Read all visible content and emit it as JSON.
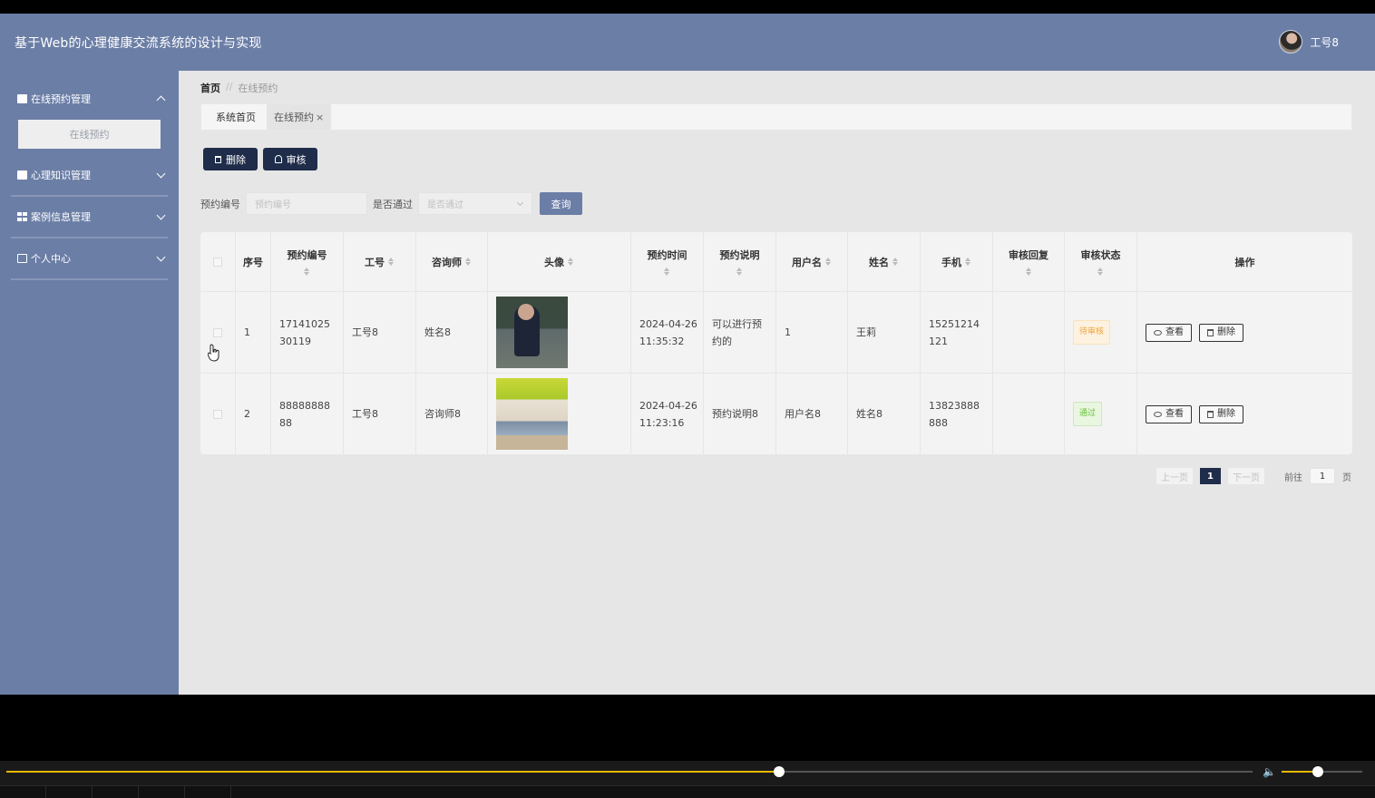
{
  "header": {
    "title": "基于Web的心理健康交流系统的设计与实现",
    "user_name": "工号8"
  },
  "sidebar": {
    "items": [
      {
        "label": "在线预约管理",
        "icon": "briefcase-icon",
        "expanded": true,
        "children": [
          {
            "label": "在线预约"
          }
        ]
      },
      {
        "label": "心理知识管理",
        "icon": "clipboard-icon",
        "expanded": false
      },
      {
        "label": "案例信息管理",
        "icon": "grid-icon",
        "expanded": false
      },
      {
        "label": "个人中心",
        "icon": "id-card-icon",
        "expanded": false
      }
    ]
  },
  "breadcrumb": {
    "home": "首页",
    "separator": "//",
    "current": "在线预约"
  },
  "tabs": [
    {
      "label": "系统首页"
    },
    {
      "label": "在线预约",
      "close": "×"
    }
  ],
  "toolbar": {
    "delete_label": "删除",
    "audit_label": "审核"
  },
  "search": {
    "field1_label": "预约编号",
    "field1_placeholder": "预约编号",
    "field2_label": "是否通过",
    "field2_placeholder": "是否通过",
    "query_label": "查询"
  },
  "table": {
    "columns": [
      "序号",
      "预约编号",
      "工号",
      "咨询师",
      "头像",
      "预约时间",
      "预约说明",
      "用户名",
      "姓名",
      "手机",
      "审核回复",
      "审核状态",
      "操作"
    ],
    "rows": [
      {
        "index": "1",
        "booking_no": "1714102530119",
        "staff_no": "工号8",
        "counselor": "姓名8",
        "time": "2024-04-26 11:35:32",
        "note": "可以进行预约的",
        "username": "1",
        "name": "王莉",
        "phone": "15251214121",
        "reply": "",
        "status": "待审核",
        "status_kind": "pending"
      },
      {
        "index": "2",
        "booking_no": "8888888888",
        "staff_no": "工号8",
        "counselor": "咨询师8",
        "time": "2024-04-26 11:23:16",
        "note": "预约说明8",
        "username": "用户名8",
        "name": "姓名8",
        "phone": "13823888888",
        "reply": "",
        "status": "通过",
        "status_kind": "pass"
      }
    ],
    "view_label": "查看",
    "delete_label": "删除"
  },
  "pagination": {
    "prev": "上一页",
    "current": "1",
    "next": "下一页",
    "goto_label": "前往",
    "goto_value": "1",
    "page_suffix": "页"
  },
  "player": {
    "progress": 0.62,
    "volume": 0.45,
    "accent": "#e6b800"
  },
  "colors": {
    "primary": "#6b7ea6",
    "dark_button": "#1f2d4a"
  }
}
